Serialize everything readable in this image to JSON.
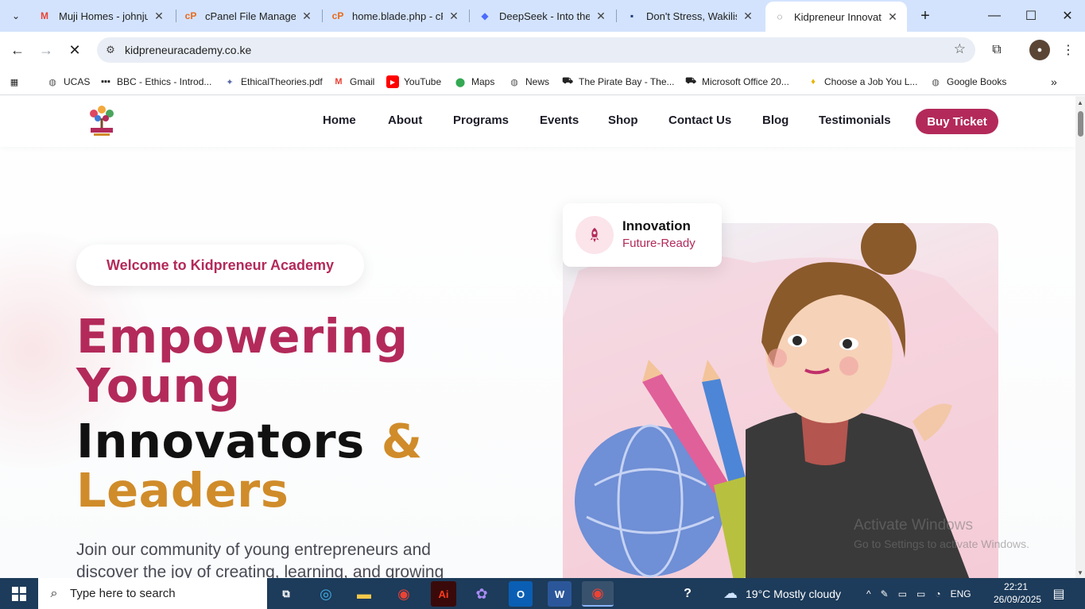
{
  "browser": {
    "tabs": [
      {
        "title": "Muji Homes - johnjur",
        "icon": "gmail-icon",
        "active": false
      },
      {
        "title": "cPanel File Manager v",
        "icon": "cpanel-icon",
        "active": false
      },
      {
        "title": "home.blade.php - cPa",
        "icon": "cpanel-icon",
        "active": false
      },
      {
        "title": "DeepSeek - Into the U",
        "icon": "deepseek-icon",
        "active": false
      },
      {
        "title": "Don't Stress, Wakilish",
        "icon": "site-icon",
        "active": false
      },
      {
        "title": "Kidpreneur Innovatio",
        "icon": "loading-icon",
        "active": true
      }
    ],
    "url": "kidpreneuracademy.co.ke",
    "bookmarks": [
      {
        "label": "UCAS",
        "icon": "globe-icon"
      },
      {
        "label": "BBC - Ethics - Introd...",
        "icon": "bbc-icon"
      },
      {
        "label": "EthicalTheories.pdf",
        "icon": "pdf-icon"
      },
      {
        "label": "Gmail",
        "icon": "gmail-icon"
      },
      {
        "label": "YouTube",
        "icon": "youtube-icon"
      },
      {
        "label": "Maps",
        "icon": "maps-icon"
      },
      {
        "label": "News",
        "icon": "globe-icon"
      },
      {
        "label": "The Pirate Bay - The...",
        "icon": "pirate-icon"
      },
      {
        "label": "Microsoft Office 20...",
        "icon": "pirate-icon"
      },
      {
        "label": "Choose a Job You L...",
        "icon": "bulb-icon"
      },
      {
        "label": "Google Books",
        "icon": "globe-icon"
      }
    ]
  },
  "site": {
    "nav": [
      "Home",
      "About",
      "Programs",
      "Events",
      "Shop",
      "Contact Us",
      "Blog",
      "Testimonials"
    ],
    "buy_ticket": "Buy Ticket",
    "welcome": "Welcome to Kidpreneur Academy",
    "headline": {
      "line1": "Empowering",
      "line2": "Young",
      "line3": "Innovators",
      "amp": "&",
      "line4": "Leaders"
    },
    "lead": "Join our community of young entrepreneurs and discover the joy of creating, learning, and growing",
    "card": {
      "title": "Innovation",
      "subtitle": "Future-Ready",
      "icon": "rocket-icon"
    },
    "watermark": {
      "line1": "Activate Windows",
      "line2": "Go to Settings to activate Windows."
    }
  },
  "taskbar": {
    "search_placeholder": "Type here to search",
    "weather": "19°C  Mostly cloudy",
    "lang": "ENG",
    "time": "22:21",
    "date": "26/09/2025"
  },
  "colors": {
    "brand": "#b32a5a",
    "accent": "#d08c2a",
    "tabstrip": "#d3e3fd",
    "taskbar": "#1d3b5a"
  }
}
